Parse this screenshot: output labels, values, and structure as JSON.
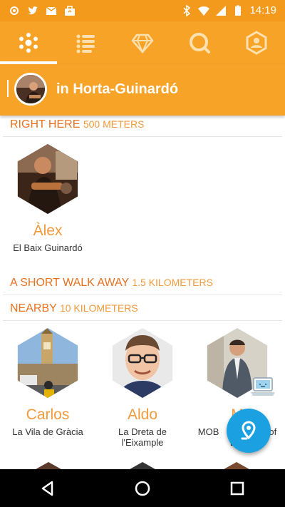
{
  "status_bar": {
    "time": "14:19",
    "left_icons": [
      "settings-app-icon",
      "twitter-icon",
      "inbox-icon",
      "briefcase-icon"
    ],
    "right_icons": [
      "bluetooth-icon",
      "wifi-icon",
      "signal-icon",
      "battery-icon"
    ]
  },
  "tabs": [
    {
      "name": "nearby-tab",
      "icon": "dots-cluster-icon",
      "active": true
    },
    {
      "name": "list-tab",
      "icon": "list-icon",
      "active": false
    },
    {
      "name": "diamond-tab",
      "icon": "diamond-icon",
      "active": false
    },
    {
      "name": "search-tab",
      "icon": "search-icon",
      "active": false
    },
    {
      "name": "profile-tab",
      "icon": "profile-icon",
      "active": false
    }
  ],
  "location": {
    "title": "in Horta-Guinardó"
  },
  "sections": {
    "right_here": {
      "title": "RIGHT HERE",
      "distance": "500 METERS"
    },
    "short_walk": {
      "title": "A SHORT WALK AWAY",
      "distance": "1.5 KILOMETERS"
    },
    "nearby": {
      "title": "NEARBY",
      "distance": "10 KILOMETERS"
    }
  },
  "people": {
    "alex": {
      "name": "Àlex",
      "area": "El Baix Guinardó"
    },
    "carlos": {
      "name": "Carlos",
      "area": "La Vila de Gràcia"
    },
    "aldo": {
      "name": "Aldo",
      "area_line1": "La Dreta de",
      "area_line2": "l'Eixample"
    },
    "m": {
      "name": "M",
      "area_line1": "MOB",
      "area_line1_end": "of",
      "area_line2": "Bar"
    }
  },
  "colors": {
    "accent": "#f7a328",
    "status_bar": "#f39a1d",
    "section_title": "#e8711f",
    "name": "#f29a3c",
    "fab": "#1ba1e2"
  }
}
